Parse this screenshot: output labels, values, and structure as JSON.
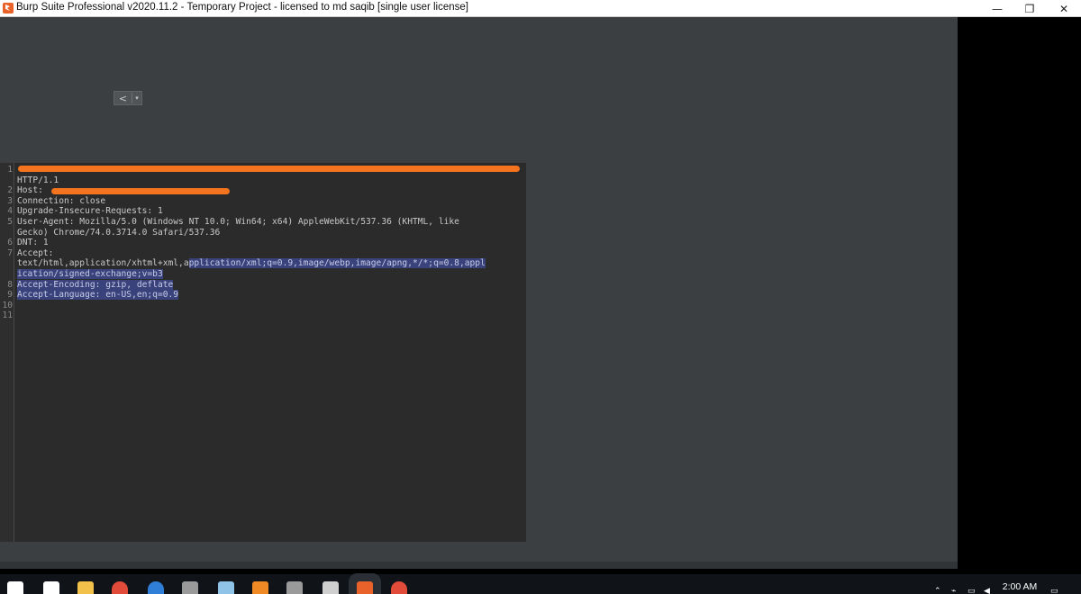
{
  "window": {
    "title": "Burp Suite Professional v2020.11.2 - Temporary Project - licensed to md saqib [single user license]",
    "minimize_glyph": "—",
    "restore_glyph": "❐",
    "close_glyph": "✕"
  },
  "toolbar": {
    "back_glyph": "<",
    "dropdown_glyph": "▾"
  },
  "request": {
    "lines": [
      {
        "n": "1",
        "text": ""
      },
      {
        "n": "",
        "text": "HTTP/1.1"
      },
      {
        "n": "2",
        "text": "Host: "
      },
      {
        "n": "3",
        "text": "Connection: close"
      },
      {
        "n": "4",
        "text": "Upgrade-Insecure-Requests: 1"
      },
      {
        "n": "5",
        "text": "User-Agent: Mozilla/5.0 (Windows NT 10.0; Win64; x64) AppleWebKit/537.36 (KHTML, like"
      },
      {
        "n": "",
        "text": "Gecko) Chrome/74.0.3714.0 Safari/537.36"
      },
      {
        "n": "6",
        "text": "DNT: 1"
      },
      {
        "n": "7",
        "text": "Accept:"
      },
      {
        "n": "",
        "text": "text/html,application/xhtml+xml,a",
        "hl": "pplication/xml;q=0.9,image/webp,image/apng,*/*;q=0.8,appl"
      },
      {
        "n": "",
        "text": "",
        "hl": "ication/signed-exchange;v=b3"
      },
      {
        "n": "8",
        "text": "",
        "hl": "Accept-Encoding: gzip, deflate"
      },
      {
        "n": "9",
        "text": "",
        "hl": "Accept-Language: en-US,en;q=0.9"
      },
      {
        "n": "10",
        "text": ""
      },
      {
        "n": "11",
        "text": ""
      }
    ]
  },
  "taskbar": {
    "clock": "2:00 AM",
    "items": [
      {
        "name": "start-icon",
        "color": "#ffffff"
      },
      {
        "name": "search-icon",
        "color": "#ffffff"
      },
      {
        "name": "file-explorer-icon",
        "color": "#f2c14a"
      },
      {
        "name": "chrome-icon",
        "color": "#e04b3a"
      },
      {
        "name": "chrome-canary-icon",
        "color": "#2f7fd8"
      },
      {
        "name": "terminal-icon",
        "color": "#9a9a9a"
      },
      {
        "name": "app-icon",
        "color": "#8fc4e8"
      },
      {
        "name": "sublime-icon",
        "color": "#f08a24"
      },
      {
        "name": "console-icon",
        "color": "#9a9a9a"
      },
      {
        "name": "window-app-icon",
        "color": "#cfcfcf"
      },
      {
        "name": "burp-icon",
        "color": "#e8622a"
      },
      {
        "name": "chrome-icon-2",
        "color": "#e04b3a"
      }
    ]
  }
}
